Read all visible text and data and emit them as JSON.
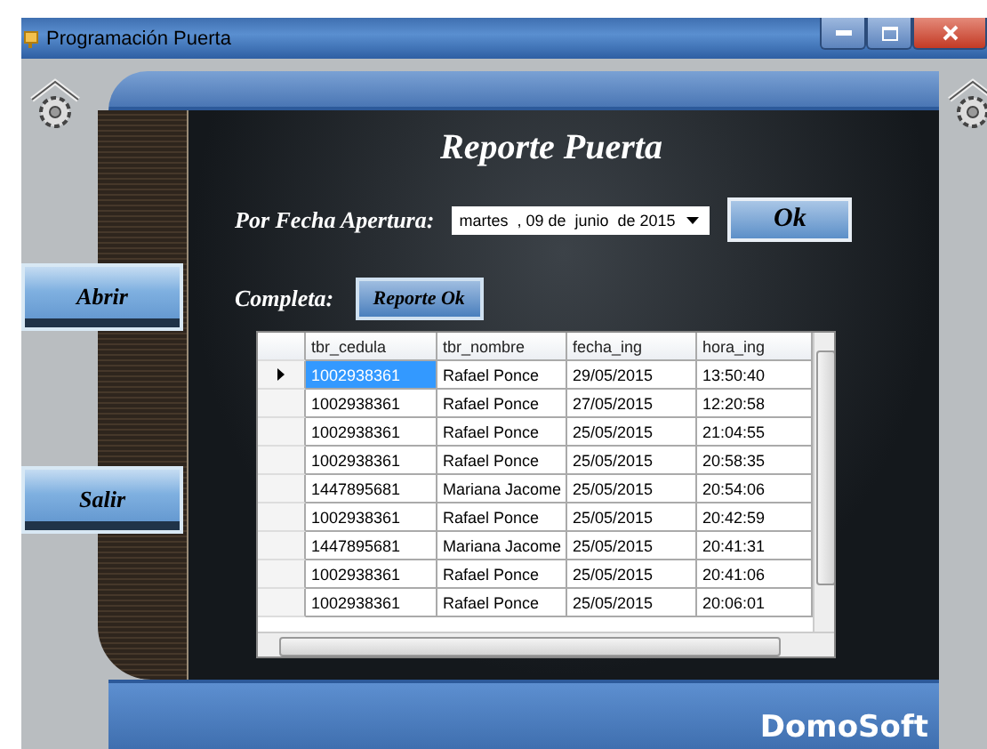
{
  "window": {
    "title": "Programación Puerta"
  },
  "side_buttons": [
    {
      "label": "Abrir"
    },
    {
      "label": "Salir"
    }
  ],
  "heading": "Reporte Puerta",
  "date_filter": {
    "label": "Por Fecha Apertura:",
    "parts": [
      "martes",
      ", 09 de",
      "junio",
      "de 2015"
    ],
    "button": "Ok"
  },
  "complete": {
    "label": "Completa:",
    "button": "Reporte Ok"
  },
  "table": {
    "columns": [
      "tbr_cedula",
      "tbr_nombre",
      "fecha_ing",
      "hora_ing"
    ],
    "rows": [
      {
        "current": true,
        "cells": [
          "1002938361",
          "Rafael Ponce",
          "29/05/2015",
          "13:50:40"
        ]
      },
      {
        "current": false,
        "cells": [
          "1002938361",
          "Rafael Ponce",
          "27/05/2015",
          "12:20:58"
        ]
      },
      {
        "current": false,
        "cells": [
          "1002938361",
          "Rafael Ponce",
          "25/05/2015",
          "21:04:55"
        ]
      },
      {
        "current": false,
        "cells": [
          "1002938361",
          "Rafael Ponce",
          "25/05/2015",
          "20:58:35"
        ]
      },
      {
        "current": false,
        "cells": [
          "1447895681",
          "Mariana Jacome",
          "25/05/2015",
          "20:54:06"
        ]
      },
      {
        "current": false,
        "cells": [
          "1002938361",
          "Rafael Ponce",
          "25/05/2015",
          "20:42:59"
        ]
      },
      {
        "current": false,
        "cells": [
          "1447895681",
          "Mariana Jacome",
          "25/05/2015",
          "20:41:31"
        ]
      },
      {
        "current": false,
        "cells": [
          "1002938361",
          "Rafael Ponce",
          "25/05/2015",
          "20:41:06"
        ]
      },
      {
        "current": false,
        "cells": [
          "1002938361",
          "Rafael Ponce",
          "25/05/2015",
          "20:06:01"
        ]
      }
    ]
  },
  "brand": "DomoSoft"
}
